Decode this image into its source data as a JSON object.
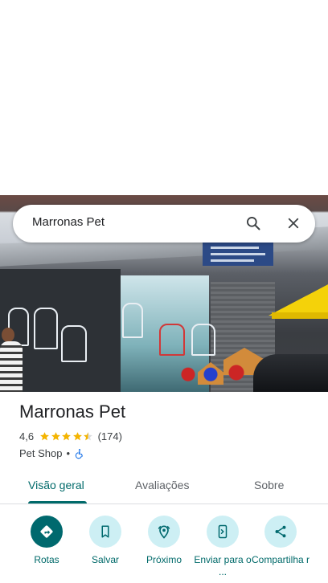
{
  "search": {
    "query": "Marronas Pet",
    "search_icon": "search-icon",
    "close_icon": "close-icon"
  },
  "place": {
    "name": "Marronas Pet",
    "rating": "4,6",
    "stars": 4.5,
    "reviews": "(174)",
    "category": "Pet Shop",
    "separator": "•",
    "accessibility_icon": "wheelchair-icon"
  },
  "tabs": [
    {
      "label": "Visão geral",
      "active": true
    },
    {
      "label": "Avaliações",
      "active": false
    },
    {
      "label": "Sobre",
      "active": false
    }
  ],
  "actions": [
    {
      "label": "Rotas",
      "icon": "directions-icon"
    },
    {
      "label": "Salvar",
      "icon": "bookmark-icon"
    },
    {
      "label": "Próximo",
      "icon": "nearby-icon"
    },
    {
      "label": "Enviar para o ...",
      "icon": "send-to-phone-icon"
    },
    {
      "label": "Compartilha r",
      "icon": "share-icon"
    }
  ],
  "colors": {
    "accent": "#006a6a",
    "primary_button": "#00696e",
    "action_background": "#cdeff4",
    "star": "#f4b400"
  }
}
